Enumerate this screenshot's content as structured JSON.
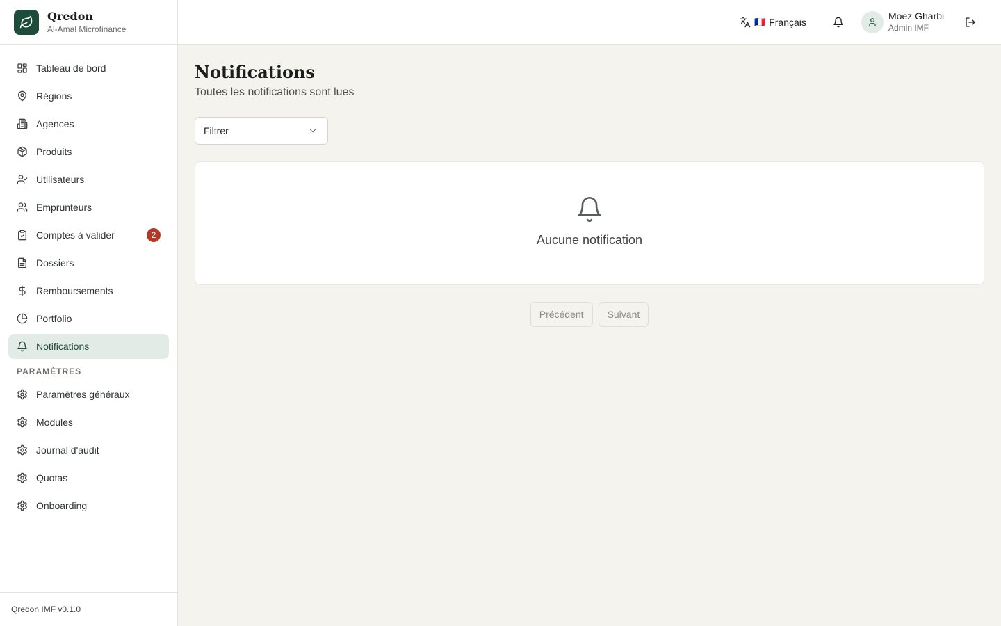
{
  "brand": {
    "name": "Qredon",
    "subtitle": "Al-Amal Microfinance"
  },
  "sidebar": {
    "items": [
      {
        "label": "Tableau de bord",
        "icon": "dashboard-icon"
      },
      {
        "label": "Régions",
        "icon": "map-pin-icon"
      },
      {
        "label": "Agences",
        "icon": "building-icon"
      },
      {
        "label": "Produits",
        "icon": "package-icon"
      },
      {
        "label": "Utilisateurs",
        "icon": "user-check-icon"
      },
      {
        "label": "Emprunteurs",
        "icon": "users-icon"
      },
      {
        "label": "Comptes à valider",
        "icon": "clipboard-check-icon",
        "badge": "2"
      },
      {
        "label": "Dossiers",
        "icon": "file-text-icon"
      },
      {
        "label": "Remboursements",
        "icon": "dollar-icon"
      },
      {
        "label": "Portfolio",
        "icon": "pie-chart-icon"
      },
      {
        "label": "Notifications",
        "icon": "bell-icon",
        "active": true
      }
    ],
    "settings_title": "PARAMÈTRES",
    "settings_items": [
      {
        "label": "Paramètres généraux",
        "icon": "gear-icon"
      },
      {
        "label": "Modules",
        "icon": "gear-icon"
      },
      {
        "label": "Journal d'audit",
        "icon": "gear-icon"
      },
      {
        "label": "Quotas",
        "icon": "gear-icon"
      },
      {
        "label": "Onboarding",
        "icon": "gear-icon"
      }
    ],
    "footer": "Qredon IMF v0.1.0"
  },
  "header": {
    "language": {
      "flag": "🇫🇷",
      "label": "Français"
    },
    "user": {
      "name": "Moez Gharbi",
      "role": "Admin IMF"
    }
  },
  "main": {
    "title": "Notifications",
    "subtitle": "Toutes les notifications sont lues",
    "filter": {
      "value": "Filtrer"
    },
    "empty_text": "Aucune notification",
    "pagination": {
      "prev": "Précédent",
      "next": "Suivant"
    }
  },
  "colors": {
    "brand": "#1d4d3a",
    "active_bg": "#e3ebe6",
    "badge": "#b33a26",
    "page_bg": "#f5f3ee"
  }
}
